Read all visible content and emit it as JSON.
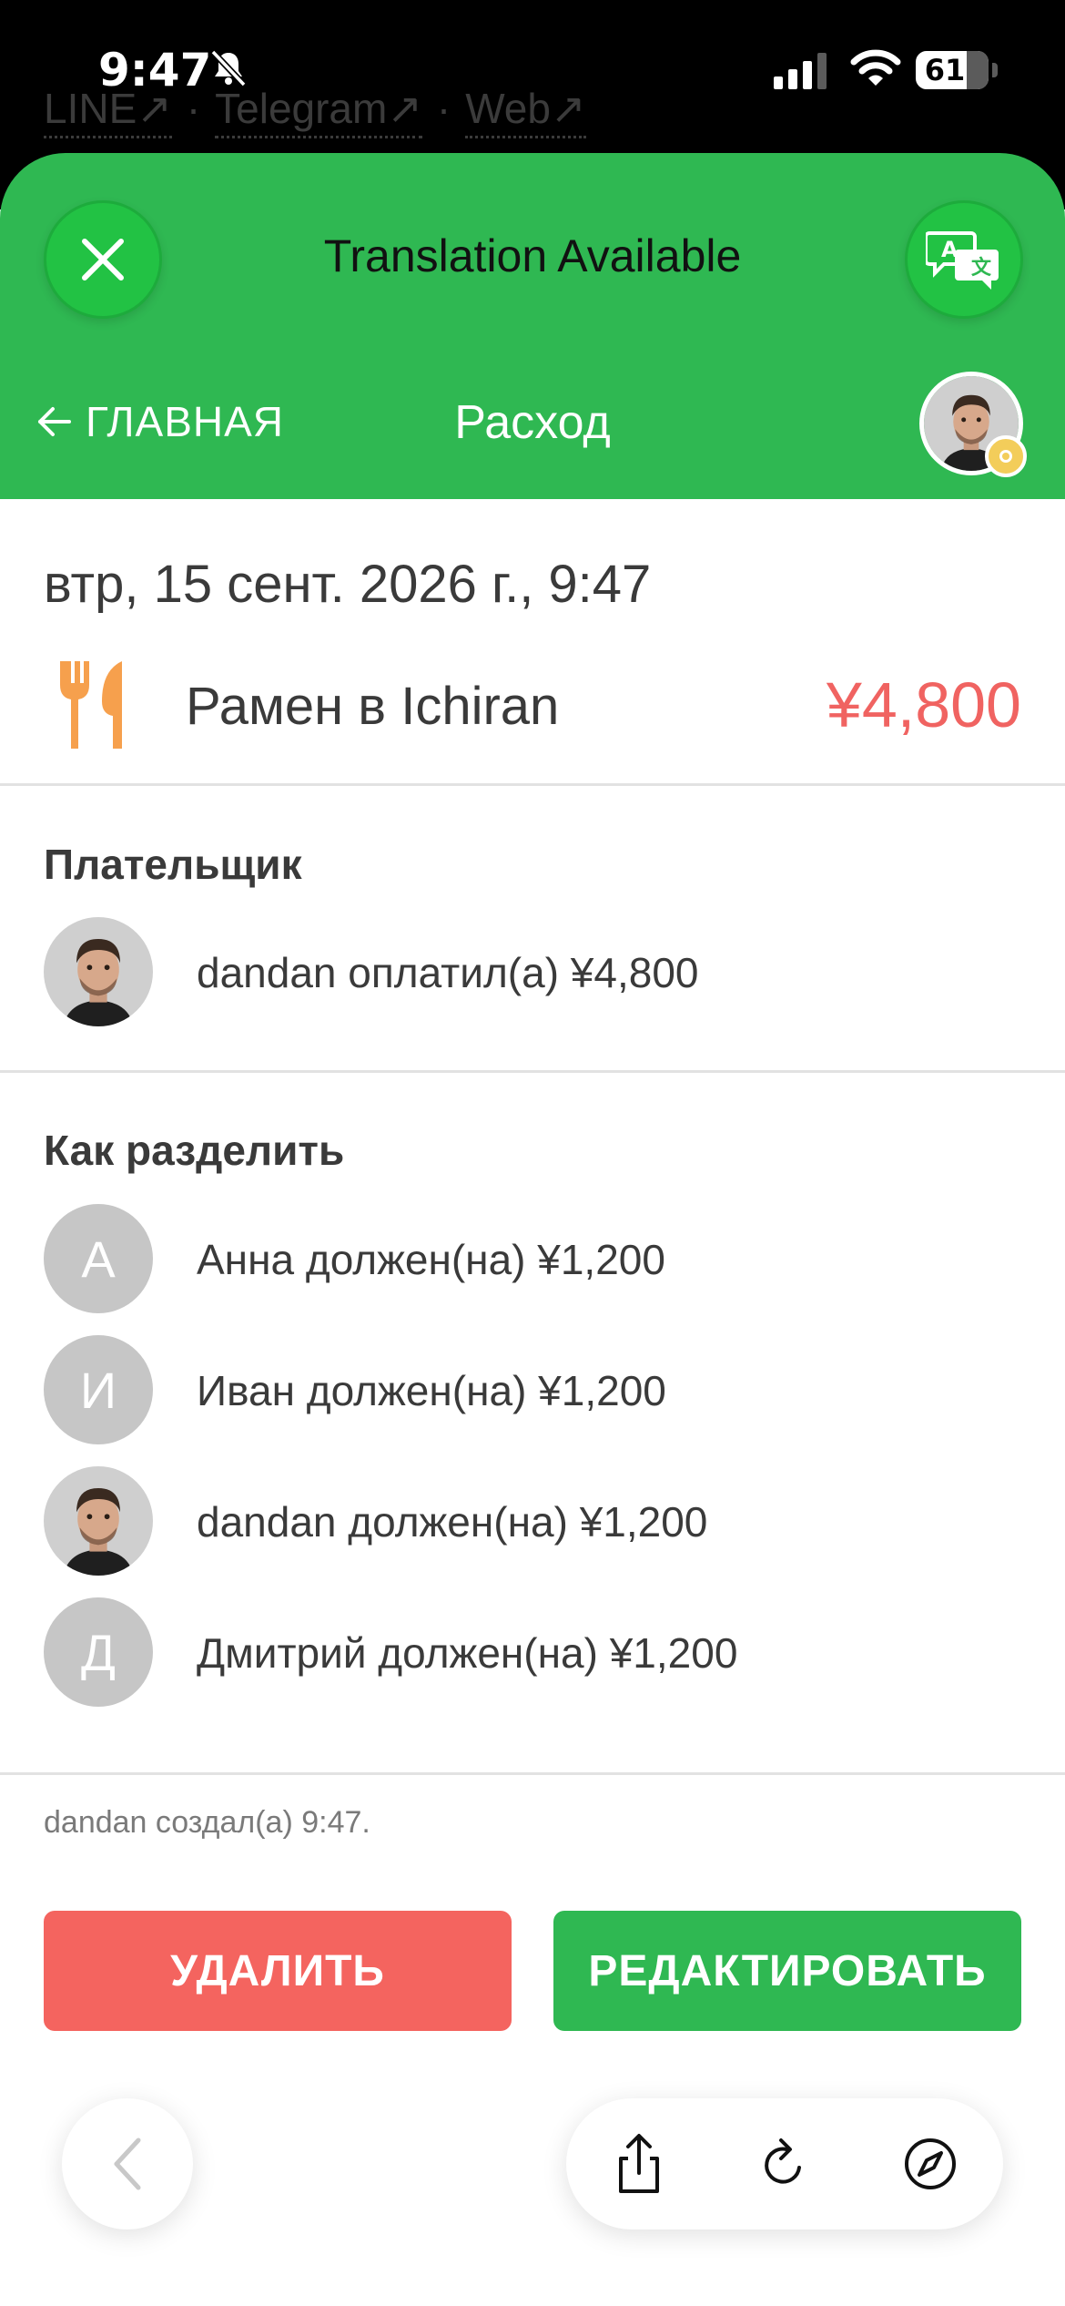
{
  "status_bar": {
    "time": "9:47",
    "battery": "61"
  },
  "browser_links": {
    "items": [
      "LINE↗",
      "Telegram↗",
      "Web↗"
    ],
    "separator": "·"
  },
  "translation_banner": {
    "title": "Translation Available"
  },
  "nav": {
    "back_label": "ГЛАВНАЯ",
    "title": "Расход"
  },
  "expense": {
    "date": "втр, 15 сент. 2026 г., 9:47",
    "category_icon": "fork-knife-icon",
    "name": "Рамен в Ichiran",
    "amount": "¥4,800"
  },
  "payer_section": {
    "title": "Плательщик",
    "payer": {
      "avatar": "photo",
      "text": "dandan оплатил(а) ¥4,800"
    }
  },
  "split_section": {
    "title": "Как разделить",
    "people": [
      {
        "avatar_letter": "А",
        "text": "Анна должен(на) ¥1,200"
      },
      {
        "avatar_letter": "И",
        "text": "Иван должен(на) ¥1,200"
      },
      {
        "avatar_letter": "",
        "text": "dandan должен(на) ¥1,200"
      },
      {
        "avatar_letter": "Д",
        "text": "Дмитрий должен(на) ¥1,200"
      }
    ]
  },
  "footer": {
    "created_note": "dandan создал(а) 9:47."
  },
  "actions": {
    "delete_label": "УДАЛИТЬ",
    "edit_label": "РЕДАКТИРОВАТЬ"
  },
  "colors": {
    "brand_green": "#2fb852",
    "danger_red": "#f4645f",
    "amount_red": "#f06361",
    "icon_orange": "#f6a04d"
  }
}
